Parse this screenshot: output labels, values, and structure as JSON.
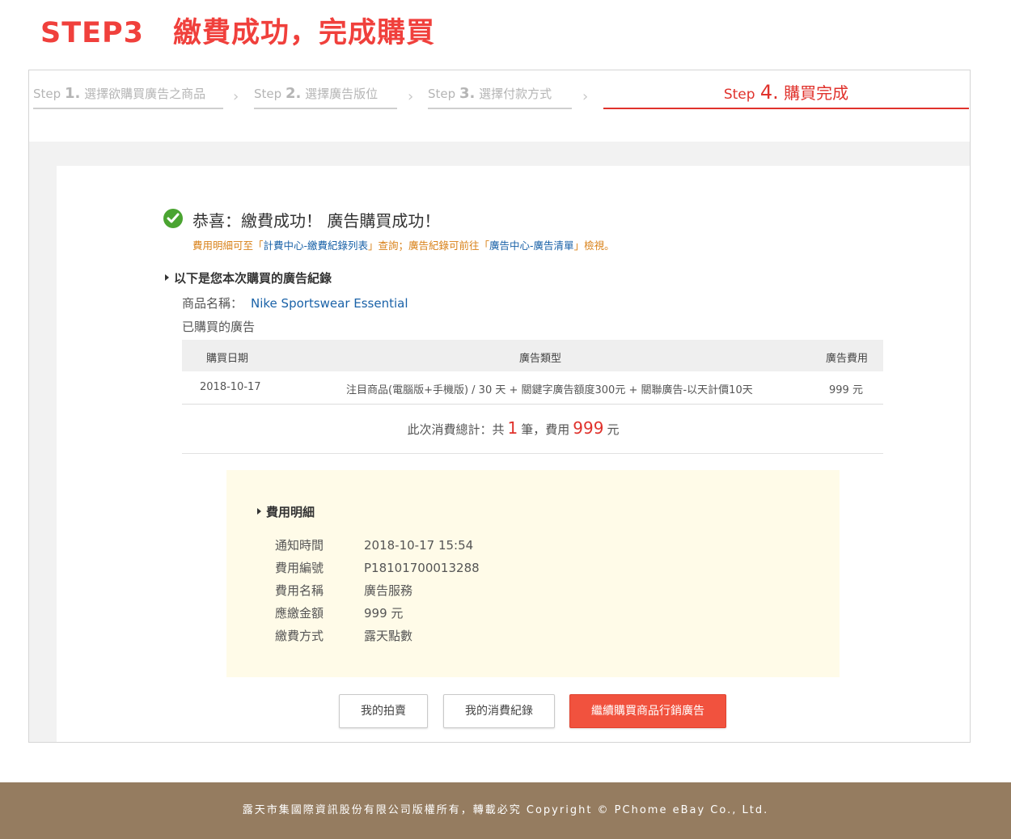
{
  "title": {
    "step": "STEP3",
    "text": "繳費成功，完成購買"
  },
  "steps": [
    {
      "prefix": "Step",
      "num": "1.",
      "label": "選擇欲購買廣告之商品"
    },
    {
      "prefix": "Step",
      "num": "2.",
      "label": "選擇廣告版位"
    },
    {
      "prefix": "Step",
      "num": "3.",
      "label": "選擇付款方式"
    },
    {
      "prefix": "Step",
      "num": "4.",
      "label": "購買完成"
    }
  ],
  "success": {
    "title": "恭喜：繳費成功！ 廣告購買成功！",
    "note_a": "費用明細可至「",
    "link_billing": "計費中心-繳費紀錄列表",
    "note_b": "」查詢；廣告紀錄可前往「",
    "link_ads": "廣告中心-廣告清單",
    "note_c": "」檢視。"
  },
  "record": {
    "heading": "以下是您本次購買的廣告紀錄",
    "product_label": "商品名稱：",
    "product_name": "Nike Sportswear Essential",
    "purchased_label": "已購買的廣告"
  },
  "table": {
    "headers": [
      "購買日期",
      "廣告類型",
      "廣告費用"
    ],
    "rows": [
      {
        "date": "2018-10-17",
        "type": "注目商品(電腦版+手機版) / 30 天 + 關鍵字廣告額度300元 + 關聯廣告-以天計價10天",
        "cost": "999 元"
      }
    ]
  },
  "total": {
    "prefix": "此次消費總計：共",
    "count": "1",
    "mid": "筆，費用",
    "amount": "999",
    "unit": "元"
  },
  "fee": {
    "heading": "費用明細",
    "rows": [
      {
        "label": "通知時間",
        "value": "2018-10-17 15:54"
      },
      {
        "label": "費用編號",
        "value": "P18101700013288"
      },
      {
        "label": "費用名稱",
        "value": "廣告服務"
      },
      {
        "label": "應繳金額",
        "value": "999 元"
      },
      {
        "label": "繳費方式",
        "value": "露天點數"
      }
    ]
  },
  "buttons": {
    "my_auction": "我的拍賣",
    "my_records": "我的消費紀錄",
    "continue": "繼續購買商品行銷廣告"
  },
  "footer": "露天市集國際資訊股份有限公司版權所有，轉載必究 Copyright © PChome eBay Co., Ltd.",
  "colors": {
    "accent": "#e0322c",
    "button_primary": "#f1523e",
    "success_green": "#4aa431",
    "footer_bg": "#957c60",
    "fee_box_bg": "#fffbe8"
  }
}
